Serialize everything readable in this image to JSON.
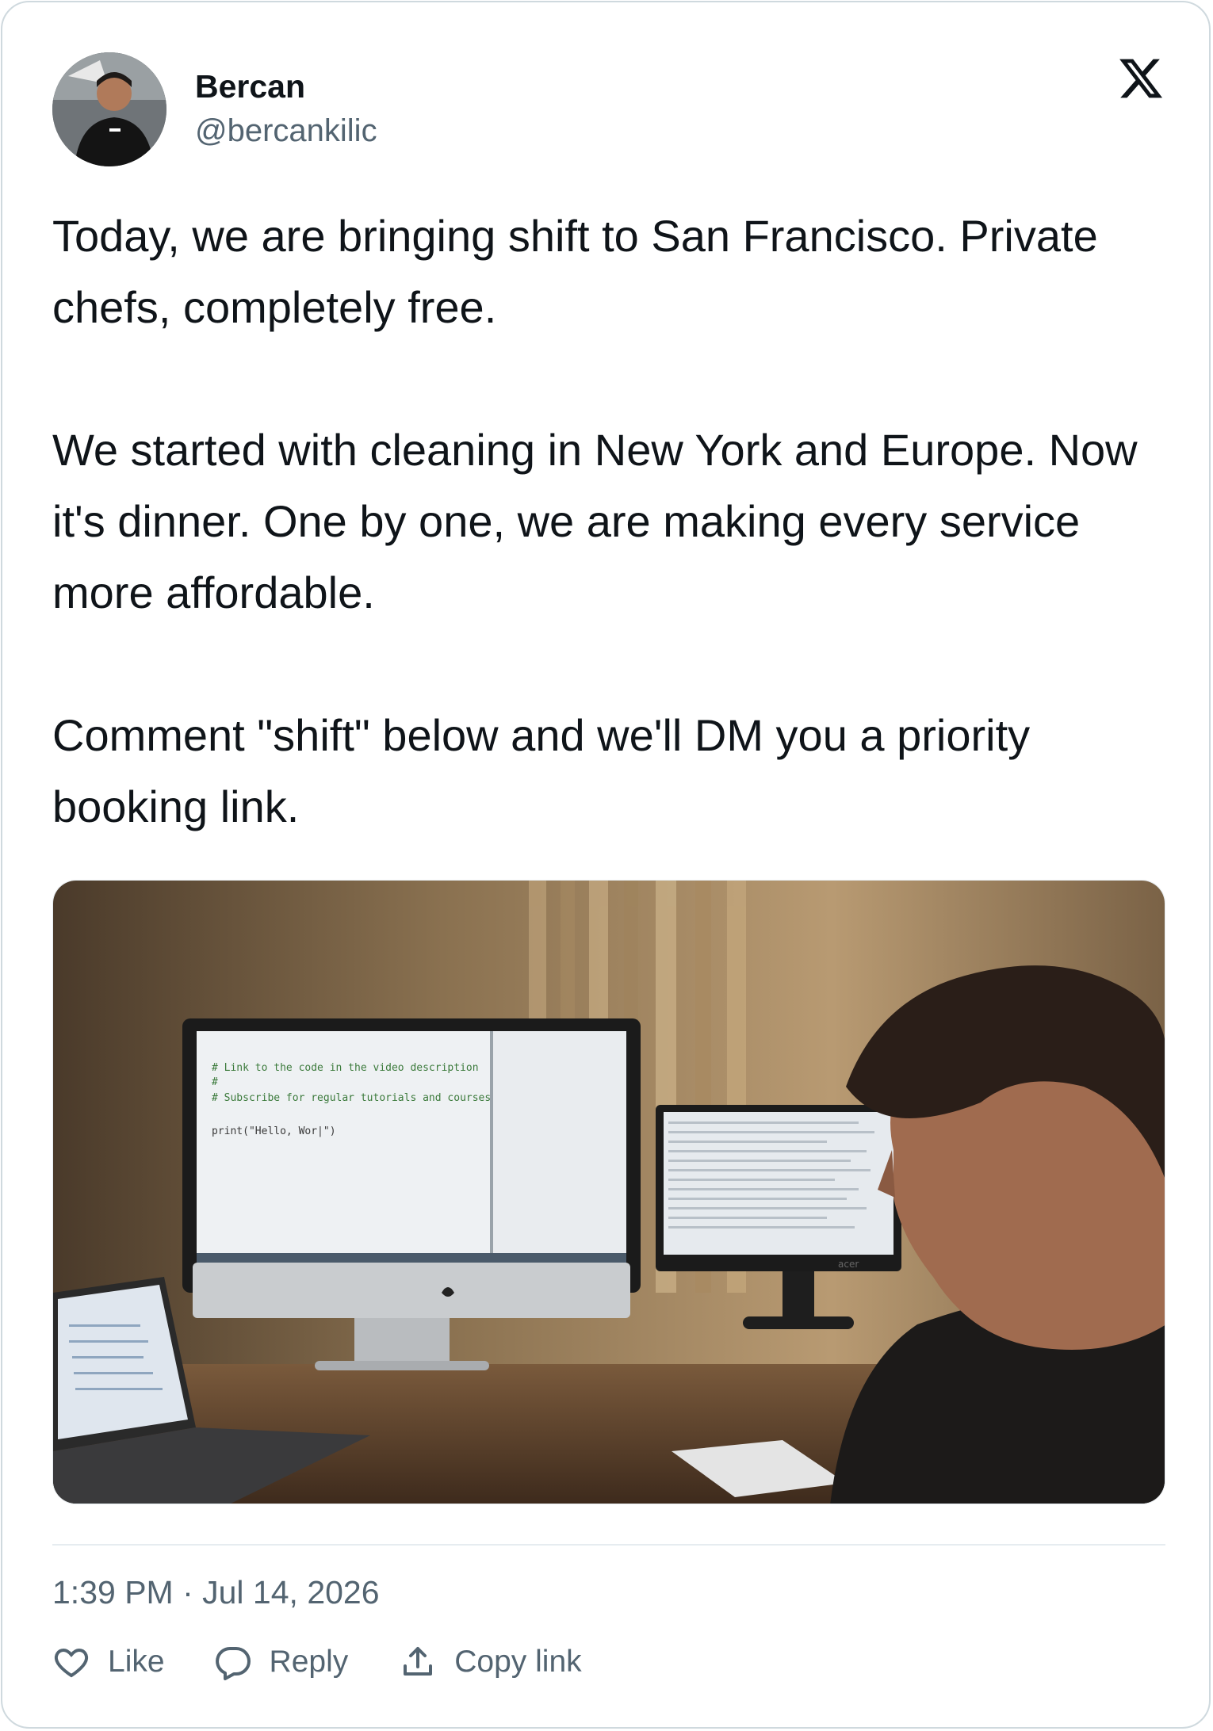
{
  "author": {
    "name": "Bercan",
    "handle": "@bercankilic"
  },
  "brand_icon": "x-logo-icon",
  "tweet": {
    "paragraphs": [
      "Today, we are bringing shift to San Francisco. Private chefs, completely free.",
      "We started with cleaning in New York and Europe. Now it's dinner. One by one, we are making every service more affordable.",
      "Comment \"shift\" below and we'll DM you a priority booking link."
    ]
  },
  "media": {
    "screen_code": [
      "# Link to the code in the video description",
      "#",
      "# Subscribe for regular tutorials and courses",
      "print(\"Hello, Wor|\")"
    ],
    "monitor_brand": "acer"
  },
  "timestamp": "1:39 PM · Jul 14, 2026",
  "actions": [
    {
      "icon": "heart-icon",
      "label": "Like"
    },
    {
      "icon": "reply-icon",
      "label": "Reply"
    },
    {
      "icon": "share-icon",
      "label": "Copy link"
    }
  ],
  "colors": {
    "text_primary": "#0f1419",
    "text_secondary": "#536471",
    "border": "#cfd9de"
  }
}
